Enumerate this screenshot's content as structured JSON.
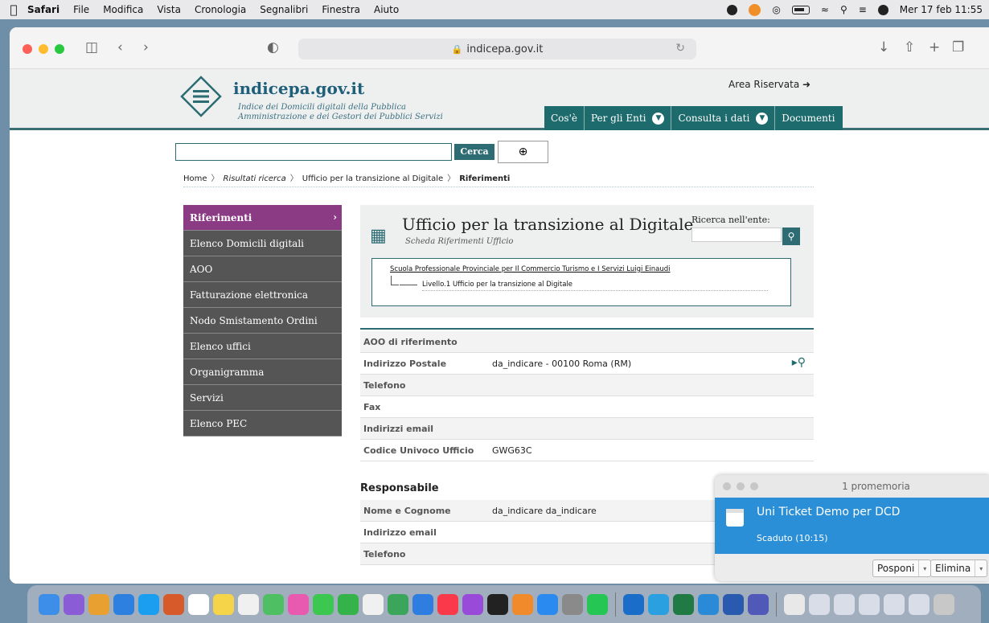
{
  "menubar": {
    "app": "Safari",
    "items": [
      "File",
      "Modifica",
      "Vista",
      "Cronologia",
      "Segnalibri",
      "Finestra",
      "Aiuto"
    ],
    "clock": "Mer 17 feb 11:55"
  },
  "browser": {
    "url": "indicepa.gov.it"
  },
  "site": {
    "logo_title": "indicepa.gov.it",
    "logo_sub1": "Indice dei Domicili digitali della Pubblica",
    "logo_sub2": "Amministrazione e dei Gestori dei Pubblici Servizi",
    "area_riservata": "Area Riservata",
    "nav": [
      "Cos'è",
      "Per gli Enti",
      "Consulta i dati",
      "Documenti"
    ],
    "search_button": "Cerca"
  },
  "breadcrumb": {
    "home": "Home",
    "results": "Risultati ricerca",
    "office": "Ufficio per la transizione al Digitale",
    "current": "Riferimenti"
  },
  "sidemenu": [
    "Riferimenti",
    "Elenco Domicili digitali",
    "AOO",
    "Fatturazione elettronica",
    "Nodo Smistamento Ordini",
    "Elenco uffici",
    "Organigramma",
    "Servizi",
    "Elenco PEC"
  ],
  "card": {
    "title": "Ufficio per la transizione al Digitale",
    "subtitle": "Scheda Riferimenti Ufficio",
    "search_label": "Ricerca nell'ente:",
    "tree_root": "Scuola Professionale Provinciale per Il Commercio Turismo e I Servizi Luigi Einaudi",
    "tree_level": "Livello.1 Ufficio per la transizione al Digitale"
  },
  "info_rows": [
    {
      "label": "AOO di riferimento",
      "value": ""
    },
    {
      "label": "Indirizzo Postale",
      "value": "da_indicare - 00100 Roma (RM)"
    },
    {
      "label": "Telefono",
      "value": ""
    },
    {
      "label": "Fax",
      "value": ""
    },
    {
      "label": "Indirizzi email",
      "value": ""
    },
    {
      "label": "Codice Univoco Ufficio",
      "value": "GWG63C"
    }
  ],
  "responsabile": {
    "title": "Responsabile",
    "rows": [
      {
        "label": "Nome e Cognome",
        "value": "da_indicare da_indicare"
      },
      {
        "label": "Indirizzo email",
        "value": ""
      },
      {
        "label": "Telefono",
        "value": ""
      }
    ]
  },
  "notification": {
    "header": "1 promemoria",
    "title": "Uni Ticket Demo per DCD",
    "subtitle": "Scaduto (10:15)",
    "snooze": "Posponi",
    "delete": "Elimina"
  },
  "colors": {
    "teal": "#1d6b6d",
    "active_menu": "#8b3a84",
    "menu_bg": "#555555",
    "notif_blue": "#2a8fd6"
  }
}
